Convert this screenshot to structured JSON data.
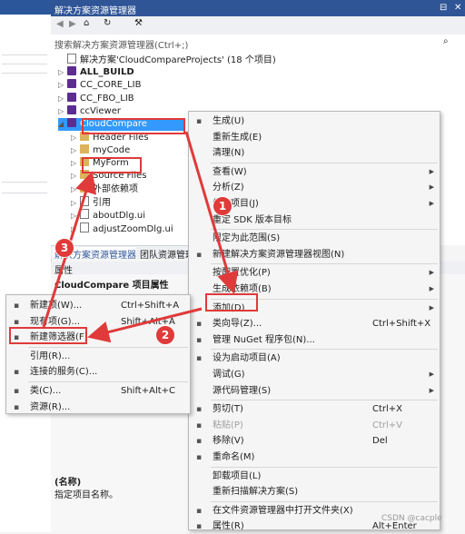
{
  "solution_explorer": {
    "title": "解决方案资源管理器",
    "search_placeholder": "搜索解决方案资源管理器(Ctrl+;)",
    "solution": "解决方案'CloudCompareProjects' (18 个项目)",
    "items": [
      {
        "label": "ALL_BUILD",
        "bold": true
      },
      {
        "label": "CC_CORE_LIB",
        "bold": false
      },
      {
        "label": "CC_FBO_LIB",
        "bold": false
      },
      {
        "label": "ccViewer",
        "bold": false
      },
      {
        "label": "CloudCompare",
        "bold": false
      },
      {
        "label": "Header Files",
        "bold": false
      },
      {
        "label": "myCode",
        "bold": false
      },
      {
        "label": "MyForm",
        "bold": false
      },
      {
        "label": "Source Files",
        "bold": false
      },
      {
        "label": "外部依赖项",
        "bold": false
      },
      {
        "label": "引用",
        "bold": false
      },
      {
        "label": "aboutDlg.ui",
        "bold": false
      },
      {
        "label": "adjustZoomDlg.ui",
        "bold": false
      }
    ]
  },
  "tabs": {
    "tab1": "解决方案资源管理器",
    "tab2": "团队资源管理器"
  },
  "properties": {
    "title": "属性",
    "object": "CloudCompare 项目属性",
    "name_label": "(名称)",
    "name_desc": "指定项目名称。"
  },
  "main_menu": [
    {
      "label": "生成(U)",
      "shortcut": "",
      "sub": false,
      "disabled": false,
      "icon": "build-icon"
    },
    {
      "label": "重新生成(E)",
      "shortcut": "",
      "sub": false,
      "disabled": false,
      "icon": ""
    },
    {
      "label": "清理(N)",
      "shortcut": "",
      "sub": false,
      "disabled": false,
      "icon": ""
    },
    {
      "label": "查看(W)",
      "shortcut": "",
      "sub": true,
      "disabled": false,
      "icon": ""
    },
    {
      "label": "分析(Z)",
      "shortcut": "",
      "sub": true,
      "disabled": false,
      "icon": ""
    },
    {
      "label": "生成项目(J)",
      "shortcut": "",
      "sub": true,
      "disabled": false,
      "icon": ""
    },
    {
      "label": "重定 SDK 版本目标",
      "shortcut": "",
      "sub": false,
      "disabled": false,
      "icon": ""
    },
    {
      "label": "限定为此范围(S)",
      "shortcut": "",
      "sub": false,
      "disabled": false,
      "icon": ""
    },
    {
      "label": "新建解决方案资源管理器视图(N)",
      "shortcut": "",
      "sub": false,
      "disabled": false,
      "icon": "new-view-icon"
    },
    {
      "label": "按配置优化(P)",
      "shortcut": "",
      "sub": true,
      "disabled": false,
      "icon": ""
    },
    {
      "label": "生成依赖项(B)",
      "shortcut": "",
      "sub": true,
      "disabled": false,
      "icon": ""
    },
    {
      "label": "添加(D)",
      "shortcut": "",
      "sub": true,
      "disabled": false,
      "icon": ""
    },
    {
      "label": "类向导(Z)...",
      "shortcut": "Ctrl+Shift+X",
      "sub": false,
      "disabled": false,
      "icon": "class-wizard-icon"
    },
    {
      "label": "管理 NuGet 程序包(N)...",
      "shortcut": "",
      "sub": false,
      "disabled": false,
      "icon": "nuget-icon"
    },
    {
      "label": "设为启动项目(A)",
      "shortcut": "",
      "sub": false,
      "disabled": false,
      "icon": "gear-icon"
    },
    {
      "label": "调试(G)",
      "shortcut": "",
      "sub": true,
      "disabled": false,
      "icon": ""
    },
    {
      "label": "源代码管理(S)",
      "shortcut": "",
      "sub": true,
      "disabled": false,
      "icon": ""
    },
    {
      "label": "剪切(T)",
      "shortcut": "Ctrl+X",
      "sub": false,
      "disabled": false,
      "icon": "cut-icon"
    },
    {
      "label": "粘贴(P)",
      "shortcut": "Ctrl+V",
      "sub": false,
      "disabled": true,
      "icon": "paste-icon"
    },
    {
      "label": "移除(V)",
      "shortcut": "Del",
      "sub": false,
      "disabled": false,
      "icon": "remove-icon"
    },
    {
      "label": "重命名(M)",
      "shortcut": "",
      "sub": false,
      "disabled": false,
      "icon": "rename-icon"
    },
    {
      "label": "卸载项目(L)",
      "shortcut": "",
      "sub": false,
      "disabled": false,
      "icon": ""
    },
    {
      "label": "重新扫描解决方案(S)",
      "shortcut": "",
      "sub": false,
      "disabled": false,
      "icon": ""
    },
    {
      "label": "在文件资源管理器中打开文件夹(X)",
      "shortcut": "",
      "sub": false,
      "disabled": false,
      "icon": "open-folder-icon"
    },
    {
      "label": "属性(R)",
      "shortcut": "Alt+Enter",
      "sub": false,
      "disabled": false,
      "icon": "wrench-icon"
    }
  ],
  "add_menu": [
    {
      "label": "新建项(W)...",
      "shortcut": "Ctrl+Shift+A",
      "icon": "new-item-icon"
    },
    {
      "label": "现有项(G)...",
      "shortcut": "Shift+Alt+A",
      "icon": "existing-item-icon"
    },
    {
      "label": "新建筛选器(F)",
      "shortcut": "",
      "icon": "filter-folder-icon"
    },
    {
      "label": "引用(R)...",
      "shortcut": "",
      "icon": ""
    },
    {
      "label": "连接的服务(C)...",
      "shortcut": "",
      "icon": "connected-service-icon"
    },
    {
      "label": "类(C)...",
      "shortcut": "Shift+Alt+C",
      "icon": "class-icon"
    },
    {
      "label": "资源(R)...",
      "shortcut": "",
      "icon": "resource-icon"
    }
  ],
  "badges": [
    "1",
    "2",
    "3"
  ],
  "watermark": "CSDN @cacple",
  "accent": "#e03a3a",
  "selection": "#3399ff"
}
